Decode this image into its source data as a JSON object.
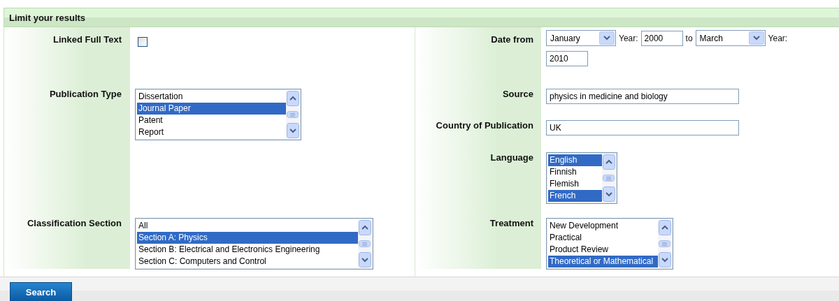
{
  "panel": {
    "title": "Limit your results"
  },
  "left_fields": [
    {
      "kind": "checkbox",
      "label": "Linked Full Text",
      "checked": false
    },
    {
      "kind": "listbox",
      "label": "Publication Type",
      "options": [
        {
          "text": "Dissertation",
          "selected": false
        },
        {
          "text": "Journal Paper",
          "selected": true
        },
        {
          "text": "Patent",
          "selected": false
        },
        {
          "text": "Report",
          "selected": false
        }
      ]
    },
    {
      "kind": "listbox",
      "label": "Classification Section",
      "options": [
        {
          "text": "All",
          "selected": false
        },
        {
          "text": "Section A: Physics",
          "selected": true
        },
        {
          "text": "Section B: Electrical and Electronics Engineering",
          "selected": false
        },
        {
          "text": "Section C: Computers and Control",
          "selected": false
        }
      ]
    }
  ],
  "right_fields": [
    {
      "kind": "date_range",
      "label": "Date from",
      "from_month": "January",
      "from_year_label": "Year:",
      "from_year": "2000",
      "to_text": "to",
      "to_month": "March",
      "to_year_label": "Year:",
      "to_year": "2010"
    },
    {
      "kind": "text",
      "label": "Source",
      "value": "physics in medicine and biology"
    },
    {
      "kind": "text",
      "label": "Country of Publication",
      "value": "UK"
    },
    {
      "kind": "listbox",
      "label": "Language",
      "options": [
        {
          "text": "English",
          "selected": true
        },
        {
          "text": "Finnish",
          "selected": false
        },
        {
          "text": "Flemish",
          "selected": false
        },
        {
          "text": "French",
          "selected": true
        }
      ]
    },
    {
      "kind": "listbox",
      "label": "Treatment",
      "options": [
        {
          "text": "New Development",
          "selected": false
        },
        {
          "text": "Practical",
          "selected": false
        },
        {
          "text": "Product Review",
          "selected": false
        },
        {
          "text": "Theoretical or Mathematical",
          "selected": true
        }
      ]
    }
  ],
  "buttons": [
    {
      "label": "Search"
    }
  ]
}
